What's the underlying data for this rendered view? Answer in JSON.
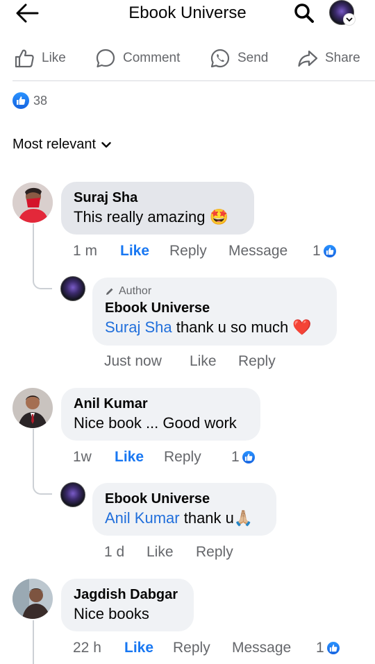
{
  "header": {
    "title": "Ebook Universe"
  },
  "actions": {
    "like": "Like",
    "comment": "Comment",
    "send": "Send",
    "share": "Share"
  },
  "reactions": {
    "count": "38"
  },
  "sort": {
    "label": "Most relevant"
  },
  "comments": [
    {
      "name": "Suraj Sha",
      "text": "This really amazing",
      "emoji": "🤩",
      "time": "1 m",
      "like": "Like",
      "reply": "Reply",
      "message": "Message",
      "likes": "1",
      "reply_item": {
        "author_tag": "Author",
        "name": "Ebook Universe",
        "mention": "Suraj Sha",
        "text": "thank u so much",
        "emoji": "❤️",
        "time": "Just now",
        "like": "Like",
        "reply": "Reply"
      }
    },
    {
      "name": "Anil Kumar",
      "text": "Nice book ... Good work",
      "time": "1w",
      "like": "Like",
      "reply": "Reply",
      "likes": "1",
      "reply_item": {
        "name": "Ebook Universe",
        "mention": "Anil Kumar",
        "text": "thank u",
        "emoji": "🙏🏼",
        "time": "1 d",
        "like": "Like",
        "reply": "Reply"
      }
    },
    {
      "name": "Jagdish Dabgar",
      "text": "Nice books",
      "time": "22 h",
      "like": "Like",
      "reply": "Reply",
      "message": "Message",
      "likes": "1"
    }
  ],
  "colors": {
    "link": "#216fdb",
    "like_active": "#1877f2",
    "secondary_text": "#65676b"
  }
}
